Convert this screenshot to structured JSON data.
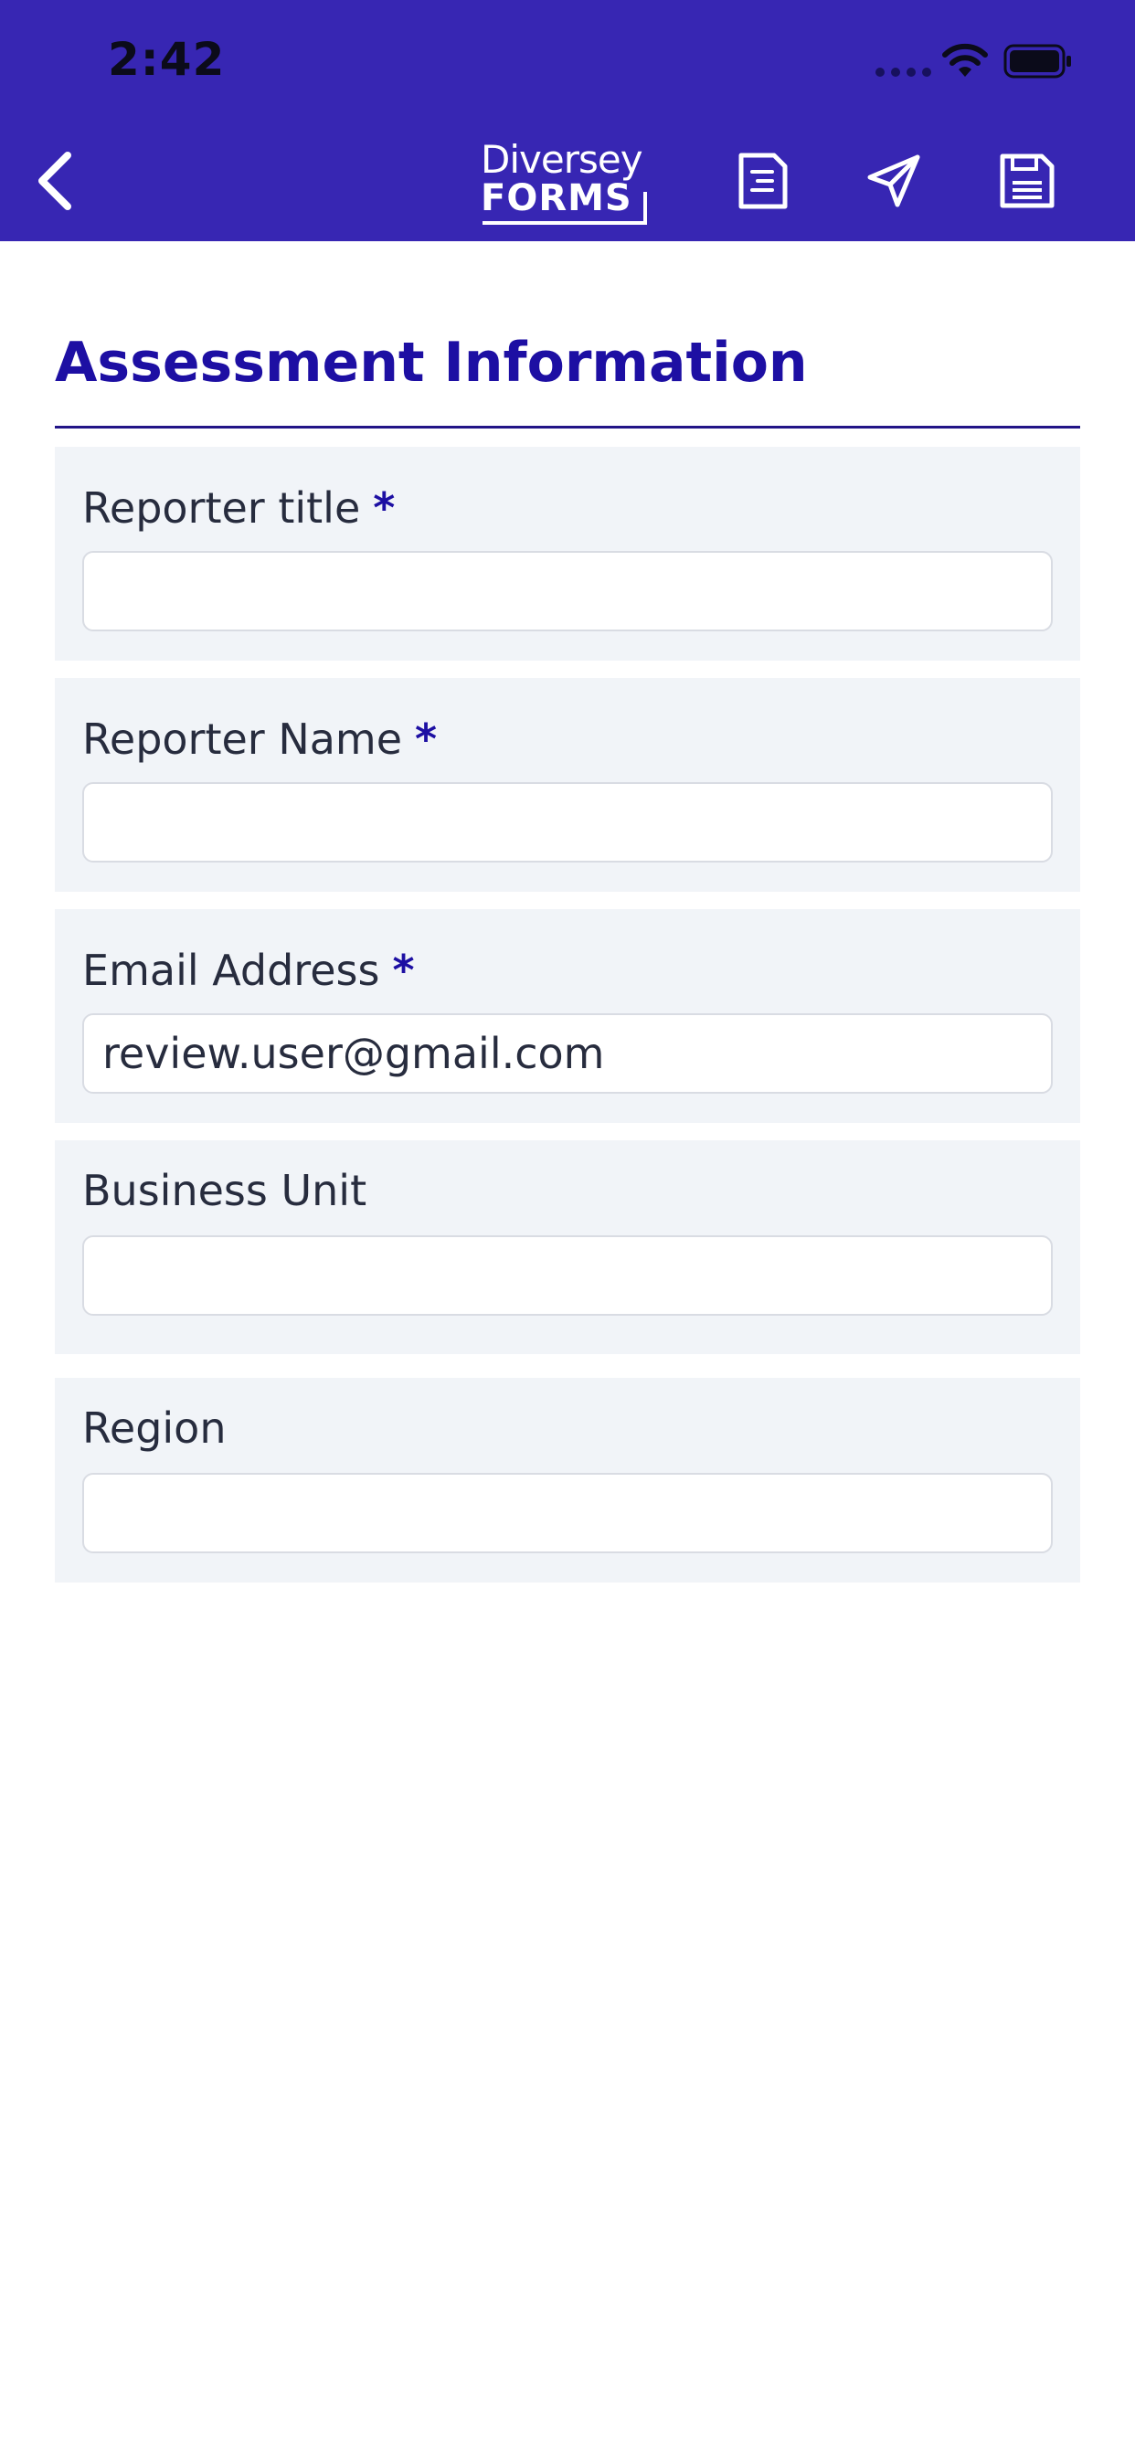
{
  "status_bar": {
    "time": "2:42"
  },
  "header": {
    "logo_line1": "Diversey",
    "logo_line2": "FORMS",
    "icons": [
      "chevron-left-icon",
      "document-icon",
      "send-icon",
      "save-icon"
    ]
  },
  "section": {
    "title": "Assessment Information"
  },
  "required_marker": "*",
  "fields": [
    {
      "label": "Reporter title",
      "required": true,
      "value": ""
    },
    {
      "label": "Reporter Name",
      "required": true,
      "value": ""
    },
    {
      "label": "Email Address",
      "required": true,
      "value": "review.user@gmail.com"
    },
    {
      "label": "Business Unit",
      "required": false,
      "value": ""
    },
    {
      "label": "Region",
      "required": false,
      "value": ""
    }
  ],
  "colors": {
    "header_bg": "#3726b3",
    "accent": "#1d0fa3",
    "field_bg": "#f1f4f8",
    "text": "#272c3e"
  }
}
